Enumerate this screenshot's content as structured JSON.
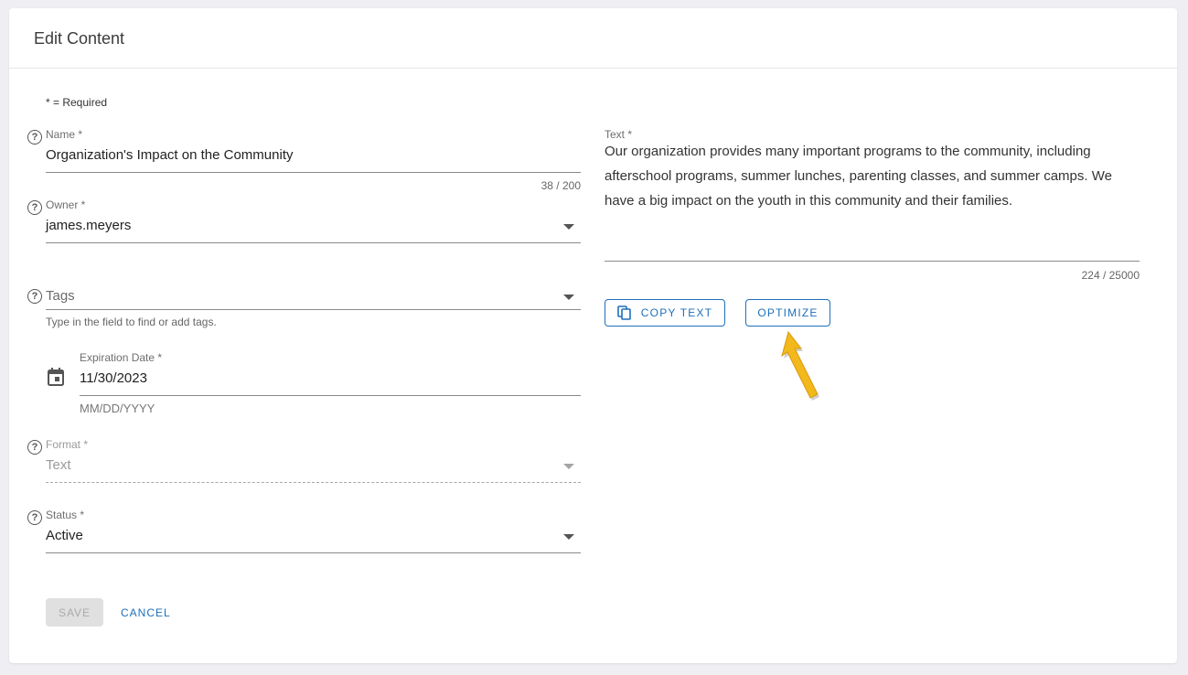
{
  "header": {
    "title": "Edit Content"
  },
  "form": {
    "required_note": "* = Required",
    "name": {
      "label": "Name *",
      "value": "Organization's Impact on the Community",
      "counter": "38 / 200"
    },
    "owner": {
      "label": "Owner *",
      "value": "james.meyers"
    },
    "tags": {
      "placeholder": "Tags",
      "hint": "Type in the field to find or add tags."
    },
    "expiration": {
      "label": "Expiration Date *",
      "value": "11/30/2023",
      "hint": "MM/DD/YYYY"
    },
    "format": {
      "label": "Format *",
      "value": "Text"
    },
    "status": {
      "label": "Status *",
      "value": "Active"
    },
    "text": {
      "label": "Text *",
      "value": "Our organization provides many important programs to the community, including afterschool programs, summer lunches, parenting classes, and summer camps. We have a big impact on the youth in this community and their families.",
      "counter": "224 / 25000"
    }
  },
  "actions": {
    "copy_text": "COPY TEXT",
    "optimize": "OPTIMIZE",
    "save": "SAVE",
    "cancel": "CANCEL"
  },
  "icons": {
    "help": "?",
    "arrow_color": "#f2b81c",
    "accent": "#1e6fba"
  }
}
